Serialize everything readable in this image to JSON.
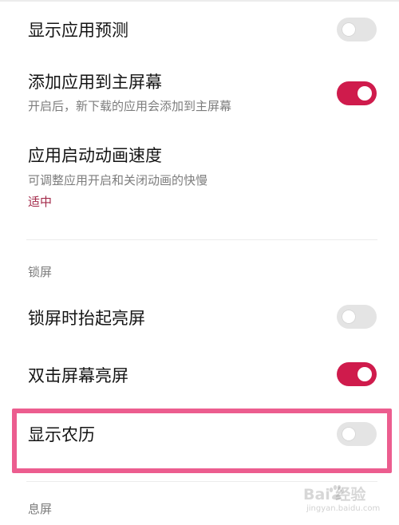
{
  "settings": [
    {
      "title": "显示应用预测",
      "toggle": "off"
    },
    {
      "title": "添加应用到主屏幕",
      "desc": "开启后，新下载的应用会添加到主屏幕",
      "toggle": "on"
    },
    {
      "title": "应用启动动画速度",
      "desc": "可调整应用开启和关闭动画的快慢",
      "value": "适中"
    }
  ],
  "lock_section": {
    "header": "锁屏",
    "items": [
      {
        "title": "锁屏时抬起亮屏",
        "toggle": "off"
      },
      {
        "title": "双击屏幕亮屏",
        "toggle": "on"
      },
      {
        "title": "显示农历",
        "toggle": "off"
      }
    ]
  },
  "screen_off_section": {
    "header": "息屏"
  },
  "watermark": {
    "logo": "Bai 经验",
    "url": "jingyan.baidu.com"
  },
  "colors": {
    "toggle_on": "#cf1b4c",
    "toggle_off": "#e4e4e4",
    "value_text": "#a32a4a",
    "highlight_border": "#ec5d8f"
  }
}
